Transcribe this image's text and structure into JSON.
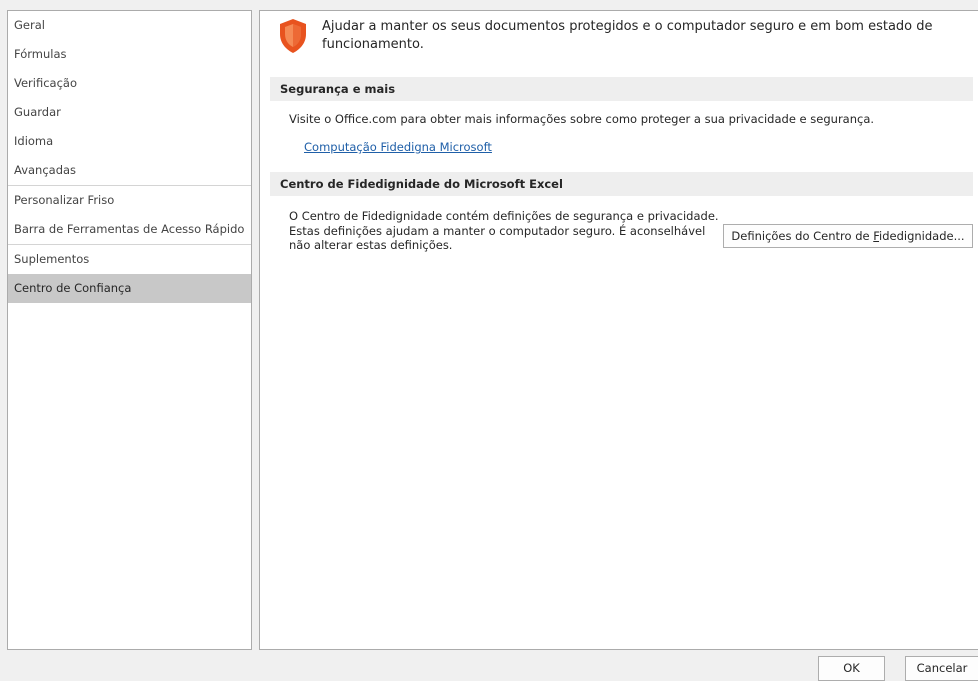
{
  "sidebar": {
    "items": [
      {
        "label": "Geral"
      },
      {
        "label": "Fórmulas"
      },
      {
        "label": "Verificação"
      },
      {
        "label": "Guardar"
      },
      {
        "label": "Idioma"
      },
      {
        "label": "Avançadas"
      },
      {
        "label": "Personalizar Friso"
      },
      {
        "label": "Barra de Ferramentas de Acesso Rápido"
      },
      {
        "label": "Suplementos"
      },
      {
        "label": "Centro de Confiança",
        "selected": true
      }
    ]
  },
  "header": {
    "text": "Ajudar a manter os seus documentos protegidos e o computador seguro e em bom estado de funcionamento.",
    "icon": "shield-icon",
    "icon_color": "#e8531f"
  },
  "security_section": {
    "title": "Segurança e mais",
    "description": "Visite o Office.com para obter mais informações sobre como proteger a sua privacidade e segurança.",
    "link": "Computação Fidedigna Microsoft"
  },
  "trust_center_section": {
    "title": "Centro de Fidedignidade do Microsoft Excel",
    "description": "O Centro de Fidedignidade contém definições de segurança e privacidade. Estas definições ajudam a manter o computador seguro. É aconselhável não alterar estas definições.",
    "button": {
      "before": "Definições do Centro de ",
      "accel": "F",
      "after": "idedignidade..."
    }
  },
  "footer": {
    "ok": "OK",
    "cancel": "Cancelar"
  },
  "colors": {
    "selected_bg": "#c8c8c8",
    "link": "#1f5fa8",
    "section_bg": "#eeeeee"
  }
}
